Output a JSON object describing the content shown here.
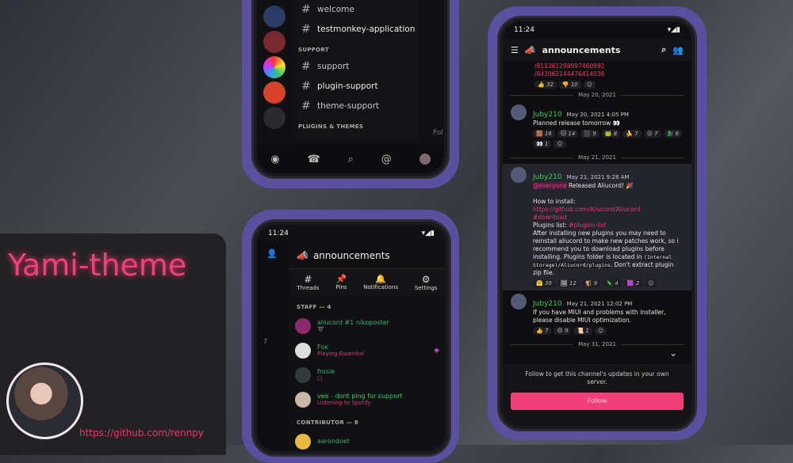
{
  "promo": {
    "title": "Yami-theme",
    "link": "https://github.com/rennpy"
  },
  "phone_top": {
    "channels": [
      {
        "name": "welcome",
        "bold": false
      },
      {
        "name": "testmonkey-application",
        "bold": true
      }
    ],
    "support_category": "SUPPORT",
    "support_channels": [
      {
        "name": "support"
      },
      {
        "name": "plugin-support"
      },
      {
        "name": "theme-support"
      }
    ],
    "plugins_category": "PLUGINS & THEMES",
    "peek_text": "Fol"
  },
  "phone_members": {
    "time": "11:24",
    "channel": "announcements",
    "tabs": [
      {
        "label": "Threads",
        "icon": "#"
      },
      {
        "label": "Pins",
        "icon": "📌"
      },
      {
        "label": "Notifications",
        "icon": "🔔"
      },
      {
        "label": "Settings",
        "icon": "⚙"
      }
    ],
    "staff_header": "STAFF — 4",
    "staff": [
      {
        "name": "aliucord #1 nikoposter",
        "activity": "",
        "color": "#2bb673"
      },
      {
        "name": "Fox",
        "activity": "Playing Essential",
        "color": "#2bb673"
      },
      {
        "name": "frosie",
        "activity": "",
        "color": "#2bb673"
      },
      {
        "name": "vee - dont ping for support",
        "activity": "Listening to Spotify",
        "color": "#2bd15b"
      }
    ],
    "contributor_header": "CONTRIBUTOR — 8",
    "contributors": [
      {
        "name": "aarondoet"
      }
    ],
    "peek_count": "7"
  },
  "phone_chat": {
    "time": "11:24",
    "channel": "announcements",
    "top_links": [
      "/811261298997460992",
      "/842062144476414036"
    ],
    "top_reactions": [
      {
        "e": "👍",
        "n": "32"
      },
      {
        "e": "👎",
        "n": "10"
      }
    ],
    "messages": [
      {
        "date": "May 20, 2021",
        "user": "Juby210",
        "time": "May 20, 2021 4:05 PM",
        "lines": [
          "Planned release tomorrow 👀"
        ],
        "reactions": [
          {
            "e": "🟫",
            "n": "16"
          },
          {
            "e": "🐱",
            "n": "14"
          },
          {
            "e": "⬛",
            "n": "9"
          },
          {
            "e": "🐸",
            "n": "8"
          },
          {
            "e": "🍌",
            "n": "7"
          },
          {
            "e": "😮",
            "n": "7"
          },
          {
            "e": "🐉",
            "n": "6"
          },
          {
            "e": "👀",
            "n": "1"
          }
        ]
      },
      {
        "date": "May 21, 2021",
        "user": "Juby210",
        "time": "May 21, 2021 9:28 AM",
        "mention": "@everyone",
        "first": " Released Aliucord! 🎉",
        "install": "How to install:",
        "link1": "https://github.com/Aliucord/Aliucord",
        "link2": "#download",
        "plugins_label": "Plugins list: ",
        "plugins_chan": "#plugins-list",
        "body": "After installing new plugins you may need to reinstall aliucord to make new patches work, so i recommend you to download plugins before installing. Plugins folder is located in ",
        "code": "(Internal Storage)/Aliucord/plugins",
        "body_end": ". Don't extract plugin zip file.",
        "reactions": [
          {
            "e": "🤗",
            "n": "39"
          },
          {
            "e": "🖼",
            "n": "12"
          },
          {
            "e": "🐒",
            "n": "9"
          },
          {
            "e": "🦎",
            "n": "4"
          },
          {
            "e": "🟪",
            "n": "2"
          }
        ]
      },
      {
        "user": "Juby210",
        "time": "May 21, 2021 12:02 PM",
        "lines": [
          "If you have MIUI and problems with installer, please disable MIUI optimization."
        ],
        "reactions": [
          {
            "e": "👍",
            "n": "7"
          },
          {
            "e": "😠",
            "n": "9"
          },
          {
            "e": "📜",
            "n": "1"
          }
        ]
      }
    ],
    "last_date": "May 31, 2021",
    "follow_text": "Follow to get this channel's updates in your own server.",
    "follow_button": "Follow",
    "accent": "#f0407a"
  }
}
